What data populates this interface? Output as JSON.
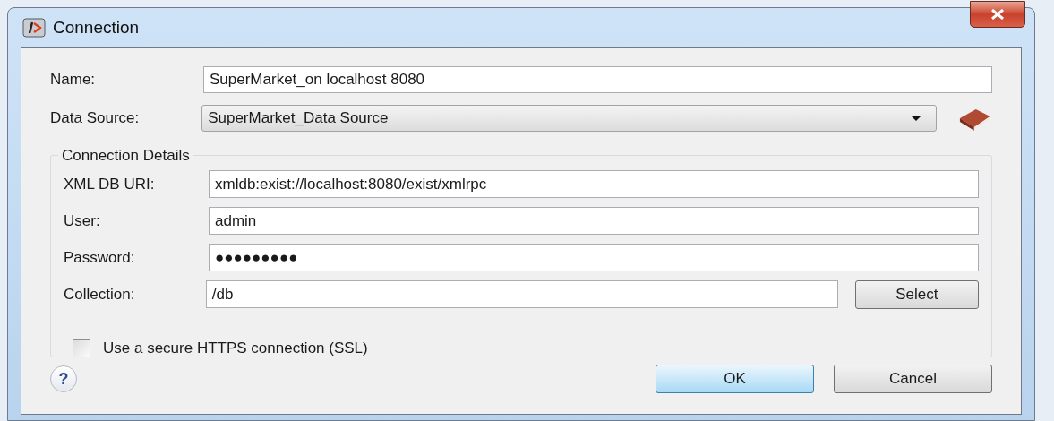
{
  "window": {
    "title": "Connection"
  },
  "name": {
    "label": "Name:",
    "value": "SuperMarket_on localhost 8080"
  },
  "data_source": {
    "label": "Data Source:",
    "value": "SuperMarket_Data Source"
  },
  "connection_details": {
    "title": "Connection Details",
    "fields": [
      {
        "label": "XML DB URI:",
        "value": "xmldb:exist://localhost:8080/exist/xmlrpc"
      },
      {
        "label": "User:",
        "value": "admin"
      },
      {
        "label": "Password:",
        "value": "●●●●●●●●●"
      },
      {
        "label": "Collection:",
        "value": "/db"
      }
    ],
    "select_button": "Select",
    "ssl": {
      "label": "Use a secure HTTPS connection (SSL)",
      "checked": false
    }
  },
  "help": "?",
  "buttons": [
    {
      "label": "OK",
      "default": true
    },
    {
      "label": "Cancel",
      "default": false
    }
  ]
}
